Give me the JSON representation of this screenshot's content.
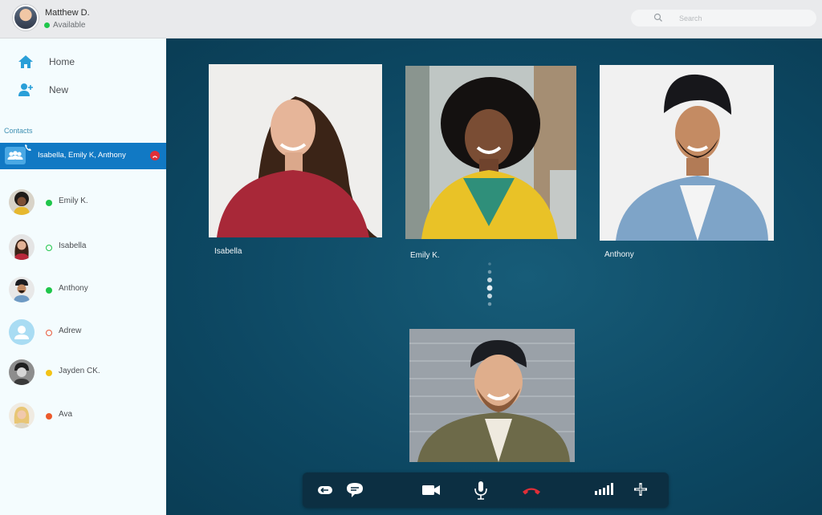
{
  "user": {
    "name": "Matthew D.",
    "status": "Available"
  },
  "search": {
    "placeholder": "Search"
  },
  "sidebar": {
    "nav": [
      {
        "label": "Home",
        "icon": "home-icon"
      },
      {
        "label": "New",
        "icon": "add-contact-icon"
      }
    ],
    "contacts_label": "Contacts",
    "active_call": {
      "label": "Isabella, Emily K, Anthony",
      "icon": "group-call-icon"
    },
    "contacts": [
      {
        "name": "Emily K.",
        "status": "online"
      },
      {
        "name": "Isabella",
        "status": "online-ring"
      },
      {
        "name": "Anthony",
        "status": "online"
      },
      {
        "name": "Adrew",
        "status": "offline-ring"
      },
      {
        "name": "Jayden CK.",
        "status": "away"
      },
      {
        "name": "Ava",
        "status": "busy"
      }
    ]
  },
  "participants": [
    {
      "name": "Isabella"
    },
    {
      "name": "Emily K."
    },
    {
      "name": "Anthony"
    }
  ],
  "self_view": {
    "label": ""
  },
  "controls": [
    "back-icon",
    "chat-icon",
    "video-camera-icon",
    "microphone-icon",
    "hang-up-icon",
    "signal-icon",
    "add-participant-icon"
  ],
  "colors": {
    "accent": "#1179c4",
    "stage": "#0c4a62",
    "hang_up": "#e02f38",
    "online": "#1fc64b"
  }
}
